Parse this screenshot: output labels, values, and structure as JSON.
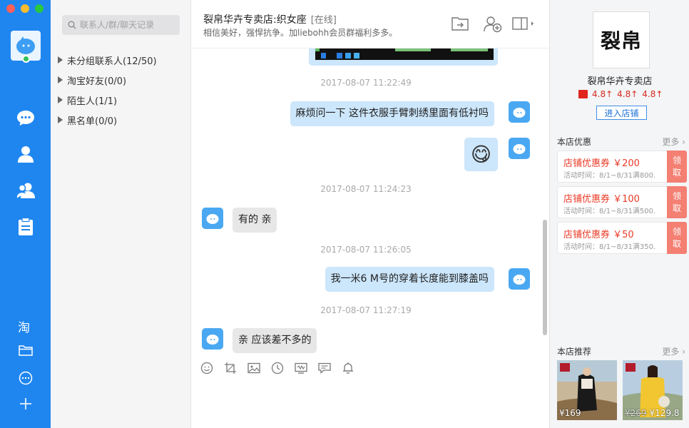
{
  "window": {
    "controls": [
      "close",
      "minimize",
      "zoom"
    ]
  },
  "rail": {
    "icons": [
      "chat-icon",
      "contact-icon",
      "group-icon",
      "clipboard-icon",
      "taobao-icon",
      "folder-icon",
      "more-icon",
      "add-icon"
    ],
    "taobao_label": "淘",
    "accent": "#1f86f0"
  },
  "contacts": {
    "search_placeholder": "联系人/群/聊天记录",
    "groups": [
      {
        "label": "未分组联系人(12/50)"
      },
      {
        "label": "淘宝好友(0/0)"
      },
      {
        "label": "陌生人(1/1)"
      },
      {
        "label": "黑名单(0/0)"
      }
    ]
  },
  "chat": {
    "title": "裂帛华卉专卖店:织女座",
    "status": "[在线]",
    "signature": "相信美好，强悍抗争。加liebohh会员群福利多多。",
    "messages": [
      {
        "time": "2017-08-07 11:22:49"
      },
      {
        "from": "me",
        "text": "麻烦问一下  这件衣服手臂刺绣里面有低衬吗"
      },
      {
        "from": "me",
        "type": "emoji",
        "emoji": "😋"
      },
      {
        "time": "2017-08-07 11:24:23"
      },
      {
        "from": "shop",
        "text": "有的 亲"
      },
      {
        "time": "2017-08-07 11:26:05"
      },
      {
        "from": "me",
        "text": "我一米6    M号的穿着长度能到膝盖吗"
      },
      {
        "time": "2017-08-07 11:27:19"
      },
      {
        "from": "shop",
        "text": "亲 应该差不多的"
      }
    ]
  },
  "shop": {
    "logo_text": "裂帛",
    "name": "裂帛华卉专卖店",
    "ratings": [
      "4.8↑",
      "4.8↑",
      "4.8↑"
    ],
    "enter_label": "进入店铺",
    "coupons_title": "本店优惠",
    "more_label": "更多",
    "coupons": [
      {
        "title": "店铺优惠券   ￥200",
        "time": "活动时间：8/1~8/31满800...",
        "take": "领取"
      },
      {
        "title": "店铺优惠券   ￥100",
        "time": "活动时间：8/1~8/31满500...",
        "take": "领取"
      },
      {
        "title": "店铺优惠券   ￥50",
        "time": "活动时间：8/1~8/31满350...",
        "take": "领取"
      }
    ],
    "rec_title": "本店推荐",
    "products": [
      {
        "price": "¥169",
        "old_price": ""
      },
      {
        "price": "¥129.8",
        "old_price": "¥269"
      }
    ]
  }
}
